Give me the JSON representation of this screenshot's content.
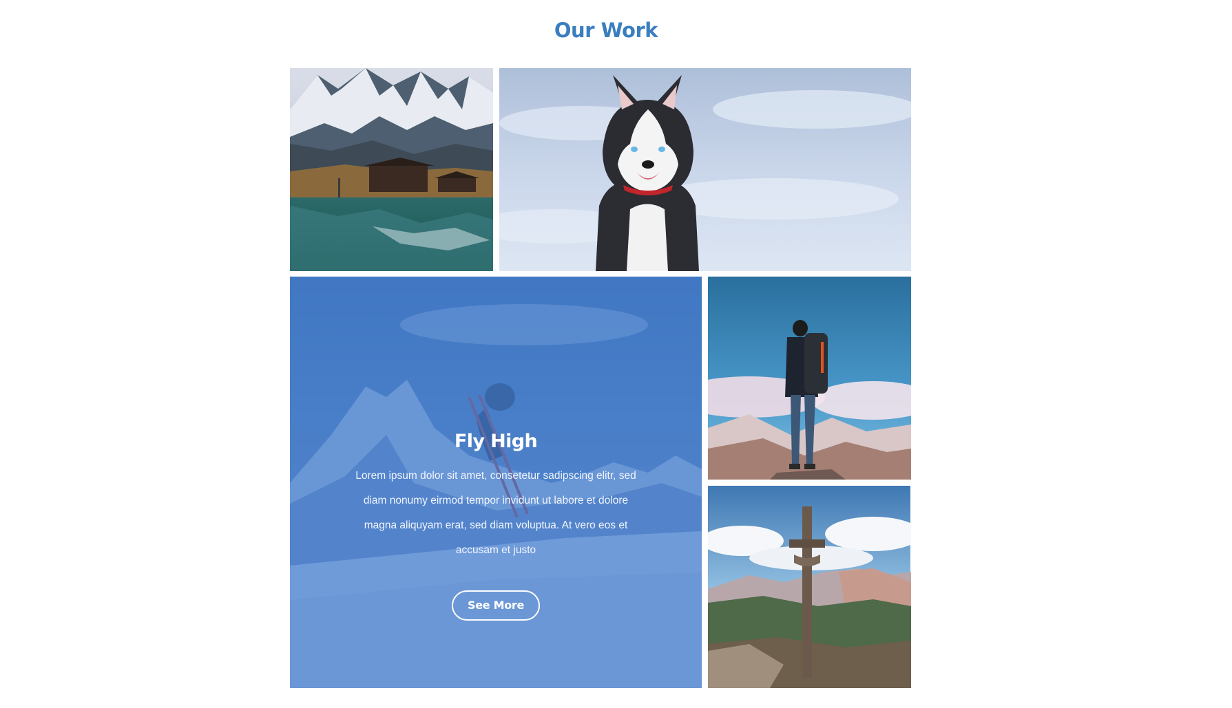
{
  "section": {
    "title": "Our Work"
  },
  "gallery": {
    "featured": {
      "title": "Fly High",
      "description": "Lorem ipsum dolor sit amet, consetetur sadipscing elitr, sed diam nonumy eirmod tempor invidunt ut labore et dolore magna aliquyam erat, sed diam voluptua. At vero eos et accusam et justo",
      "button_label": "See More",
      "overlay_color": "#427ccd"
    }
  },
  "colors": {
    "accent": "#3a7ec0",
    "background": "#ffffff",
    "overlay_text": "#ffffff"
  }
}
